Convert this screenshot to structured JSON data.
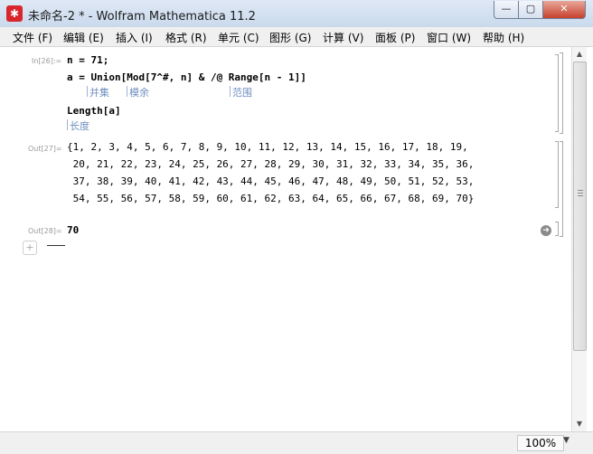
{
  "window": {
    "title": "未命名-2 * - Wolfram Mathematica 11.2",
    "app_icon": "mathematica-icon",
    "controls": {
      "minimize": "—",
      "maximize": "▢",
      "close": "✕"
    }
  },
  "menu": [
    "文件 (F)",
    "编辑 (E)",
    "插入 (I)",
    "格式 (R)",
    "单元 (C)",
    "图形 (G)",
    "计算 (V)",
    "面板 (P)",
    "窗口 (W)",
    "帮助 (H)"
  ],
  "input_cell": {
    "label": "In[26]:=",
    "lines": [
      "n = 71;",
      "a = Union[Mod[7^#, n] & /@ Range[n - 1]]",
      "Length[a]"
    ],
    "hints_line2": [
      "并集",
      "模余",
      "范围"
    ],
    "hints_line3": [
      "长度"
    ]
  },
  "output_cell_1": {
    "label": "Out[27]=",
    "lines": [
      "{1, 2, 3, 4, 5, 6, 7, 8, 9, 10, 11, 12, 13, 14, 15, 16, 17, 18, 19,",
      " 20, 21, 22, 23, 24, 25, 26, 27, 28, 29, 30, 31, 32, 33, 34, 35, 36,",
      " 37, 38, 39, 40, 41, 42, 43, 44, 45, 46, 47, 48, 49, 50, 51, 52, 53,",
      " 54, 55, 56, 57, 58, 59, 60, 61, 62, 63, 64, 65, 66, 67, 68, 69, 70}"
    ]
  },
  "output_cell_2": {
    "label": "Out[28]=",
    "value": "70",
    "icon": "go-arrow-icon"
  },
  "new_cell": {
    "plus": "+"
  },
  "scrollbar": {
    "up": "▲",
    "down": "▼"
  },
  "status": {
    "zoom": "100%",
    "zoom_arrow": "▼"
  }
}
